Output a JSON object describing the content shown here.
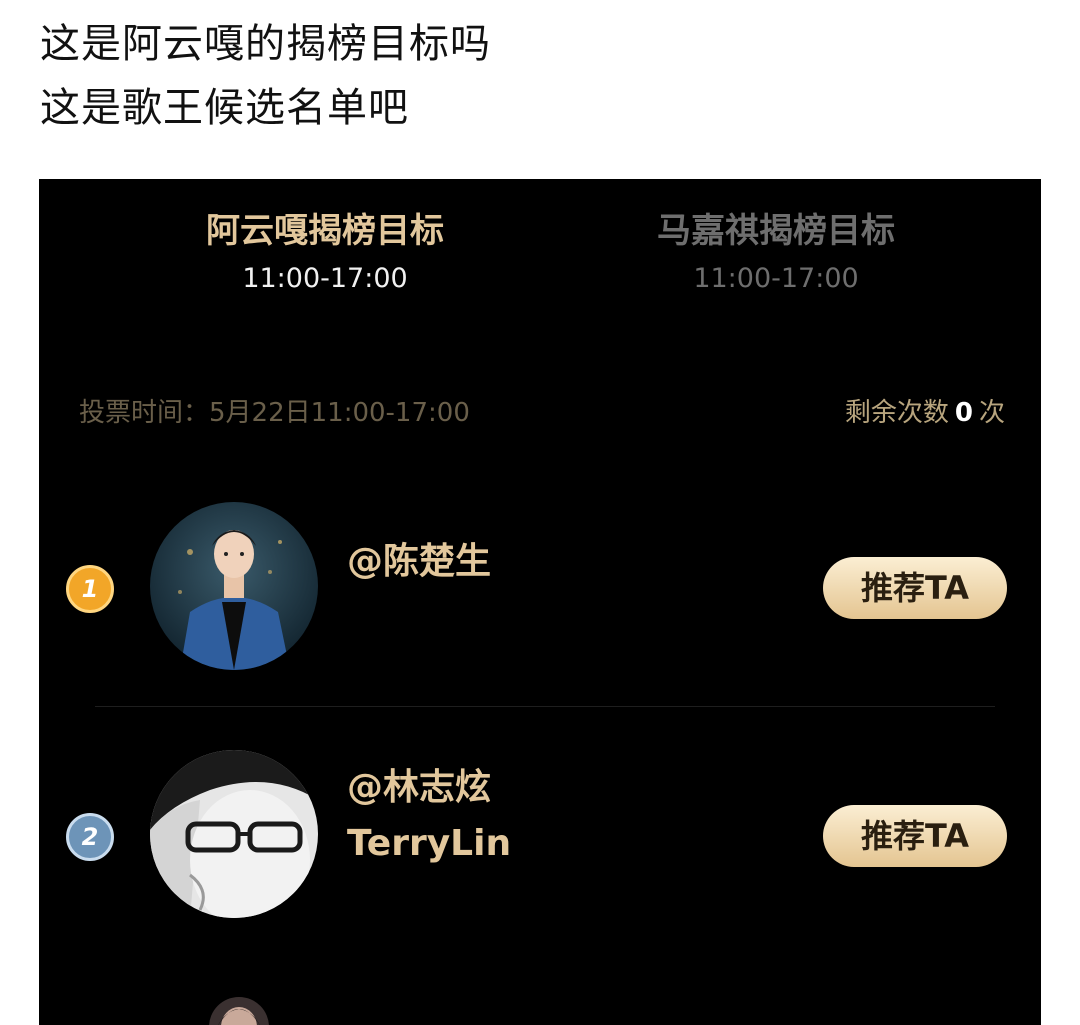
{
  "caption": {
    "line1": "这是阿云嘎的揭榜目标吗",
    "line2": "这是歌王候选名单吧"
  },
  "tabs": [
    {
      "title": "阿云嘎揭榜目标",
      "time": "11:00-17:00",
      "active": true
    },
    {
      "title": "马嘉祺揭榜目标",
      "time": "11:00-17:00",
      "active": false
    }
  ],
  "vote_info": {
    "time_text": "投票时间：5月22日11:00-17:00",
    "remaining_prefix": "剩余次数",
    "remaining_count": "0",
    "remaining_suffix": "次"
  },
  "candidates": [
    {
      "rank": "1",
      "name": "@陈楚生",
      "subname": "",
      "button_label": "推荐TA"
    },
    {
      "rank": "2",
      "name": "@林志炫",
      "subname": "TerryLin",
      "button_label": "推荐TA"
    }
  ]
}
